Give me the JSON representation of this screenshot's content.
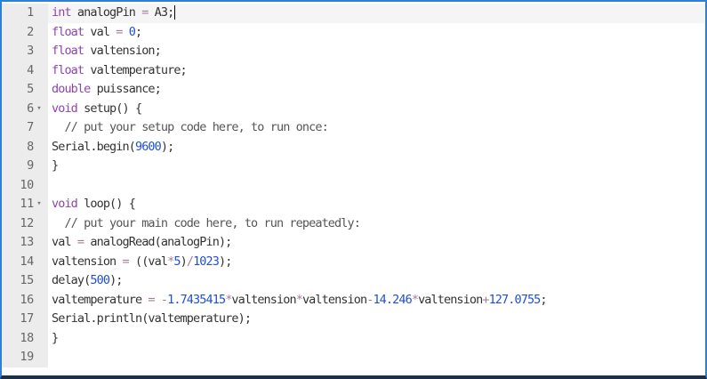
{
  "editor": {
    "lines": [
      {
        "number": "1",
        "fold": "",
        "tokens": [
          {
            "t": "kw",
            "v": "int"
          },
          {
            "t": "pl",
            "v": " analogPin "
          },
          {
            "t": "op",
            "v": "="
          },
          {
            "t": "pl",
            "v": " A3;"
          }
        ],
        "cursor": true
      },
      {
        "number": "2",
        "fold": "",
        "tokens": [
          {
            "t": "kw",
            "v": "float"
          },
          {
            "t": "pl",
            "v": " val "
          },
          {
            "t": "op",
            "v": "="
          },
          {
            "t": "pl",
            "v": " "
          },
          {
            "t": "num",
            "v": "0"
          },
          {
            "t": "pl",
            "v": ";"
          }
        ]
      },
      {
        "number": "3",
        "fold": "",
        "tokens": [
          {
            "t": "kw",
            "v": "float"
          },
          {
            "t": "pl",
            "v": " valtension;"
          }
        ]
      },
      {
        "number": "4",
        "fold": "",
        "tokens": [
          {
            "t": "kw",
            "v": "float"
          },
          {
            "t": "pl",
            "v": " valtemperature;"
          }
        ]
      },
      {
        "number": "5",
        "fold": "",
        "tokens": [
          {
            "t": "kw",
            "v": "double"
          },
          {
            "t": "pl",
            "v": " puissance;"
          }
        ]
      },
      {
        "number": "6",
        "fold": "▾",
        "tokens": [
          {
            "t": "kw",
            "v": "void"
          },
          {
            "t": "pl",
            "v": " setup() {"
          }
        ]
      },
      {
        "number": "7",
        "fold": "",
        "tokens": [
          {
            "t": "cm",
            "v": "  // put your setup code here, to run once:"
          }
        ]
      },
      {
        "number": "8",
        "fold": "",
        "tokens": [
          {
            "t": "pl",
            "v": "Serial.begin("
          },
          {
            "t": "num",
            "v": "9600"
          },
          {
            "t": "pl",
            "v": ");"
          }
        ]
      },
      {
        "number": "9",
        "fold": "",
        "tokens": [
          {
            "t": "pl",
            "v": "}"
          }
        ]
      },
      {
        "number": "10",
        "fold": "",
        "tokens": []
      },
      {
        "number": "11",
        "fold": "▾",
        "tokens": [
          {
            "t": "kw",
            "v": "void"
          },
          {
            "t": "pl",
            "v": " loop() {"
          }
        ]
      },
      {
        "number": "12",
        "fold": "",
        "tokens": [
          {
            "t": "cm",
            "v": "  // put your main code here, to run repeatedly:"
          }
        ]
      },
      {
        "number": "13",
        "fold": "",
        "tokens": [
          {
            "t": "pl",
            "v": "val "
          },
          {
            "t": "op",
            "v": "="
          },
          {
            "t": "pl",
            "v": " analogRead(analogPin);"
          }
        ]
      },
      {
        "number": "14",
        "fold": "",
        "tokens": [
          {
            "t": "pl",
            "v": "valtension "
          },
          {
            "t": "op",
            "v": "="
          },
          {
            "t": "pl",
            "v": " ((val"
          },
          {
            "t": "op",
            "v": "*"
          },
          {
            "t": "num",
            "v": "5"
          },
          {
            "t": "pl",
            "v": ")"
          },
          {
            "t": "op",
            "v": "/"
          },
          {
            "t": "num",
            "v": "1023"
          },
          {
            "t": "pl",
            "v": ");"
          }
        ]
      },
      {
        "number": "15",
        "fold": "",
        "tokens": [
          {
            "t": "pl",
            "v": "delay("
          },
          {
            "t": "num",
            "v": "500"
          },
          {
            "t": "pl",
            "v": ");"
          }
        ]
      },
      {
        "number": "16",
        "fold": "",
        "tokens": [
          {
            "t": "pl",
            "v": "valtemperature "
          },
          {
            "t": "op",
            "v": "="
          },
          {
            "t": "pl",
            "v": " "
          },
          {
            "t": "op",
            "v": "-"
          },
          {
            "t": "num",
            "v": "1.7435415"
          },
          {
            "t": "op",
            "v": "*"
          },
          {
            "t": "pl",
            "v": "valtension"
          },
          {
            "t": "op",
            "v": "*"
          },
          {
            "t": "pl",
            "v": "valtension"
          },
          {
            "t": "op",
            "v": "-"
          },
          {
            "t": "num",
            "v": "14.246"
          },
          {
            "t": "op",
            "v": "*"
          },
          {
            "t": "pl",
            "v": "valtension"
          },
          {
            "t": "op",
            "v": "+"
          },
          {
            "t": "num",
            "v": "127.0755"
          },
          {
            "t": "pl",
            "v": ";"
          }
        ]
      },
      {
        "number": "17",
        "fold": "",
        "tokens": [
          {
            "t": "pl",
            "v": "Serial.println(valtemperature);"
          }
        ]
      },
      {
        "number": "18",
        "fold": "",
        "tokens": [
          {
            "t": "pl",
            "v": "}"
          }
        ]
      },
      {
        "number": "19",
        "fold": "",
        "tokens": []
      }
    ]
  },
  "colors": {
    "keyword": "#8e44ad",
    "number": "#1f4fd6",
    "operator": "#a27b9a",
    "comment": "#555555",
    "text": "#333333",
    "frame": "#2f7fd6",
    "gutter": "#ececec"
  }
}
